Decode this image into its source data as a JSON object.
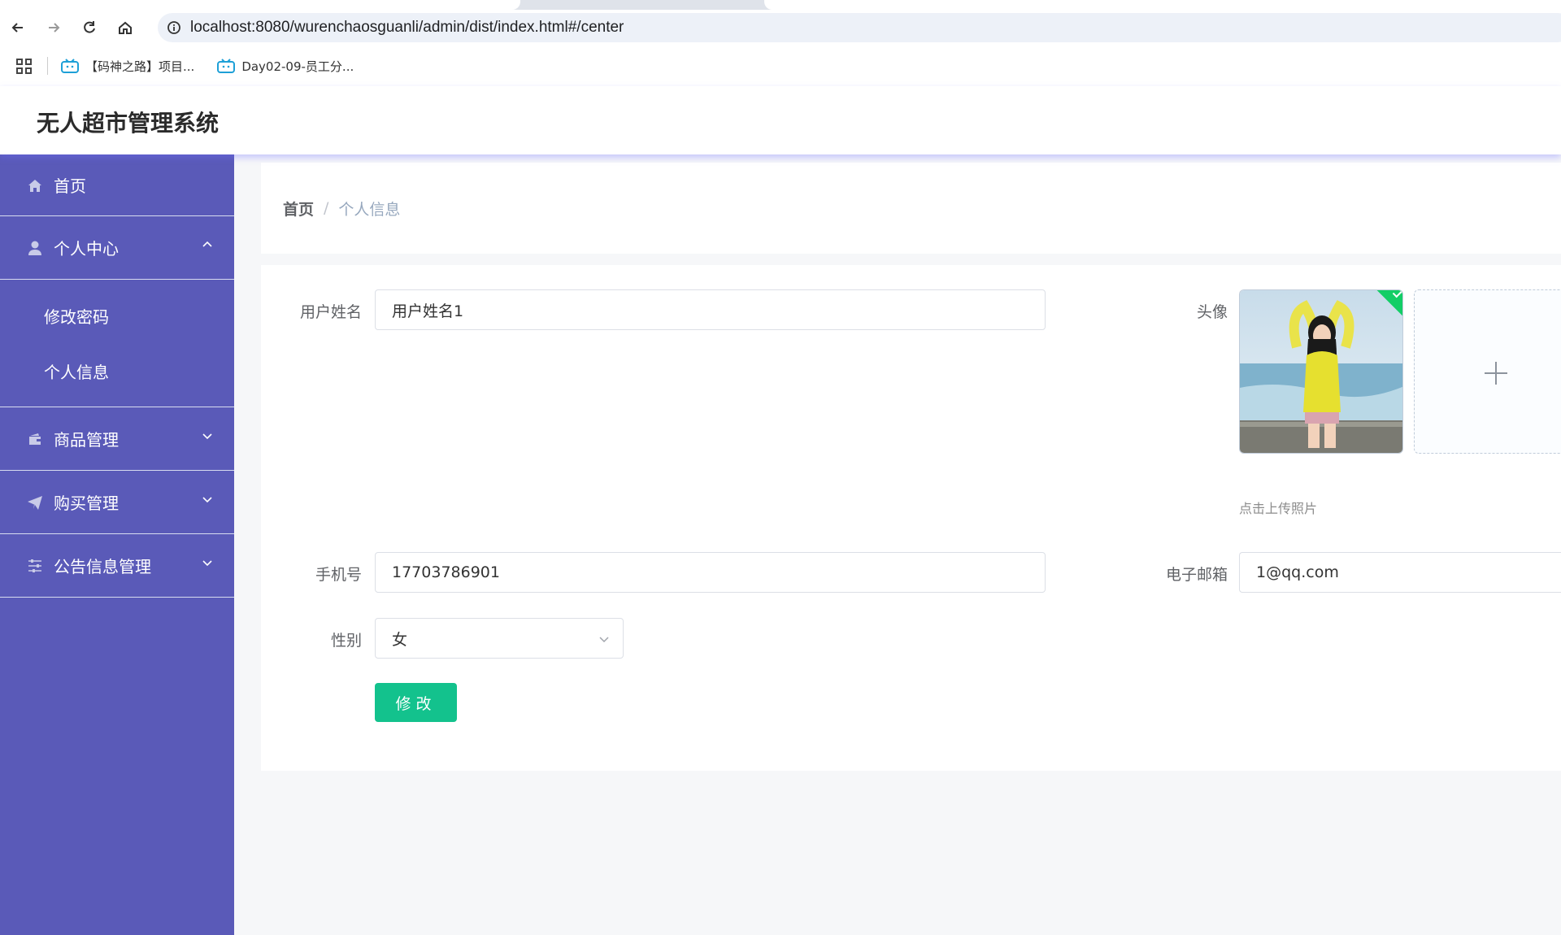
{
  "browser": {
    "url": "localhost:8080/wurenchaosguanli/admin/dist/index.html#/center",
    "icons": [
      "back-icon",
      "forward-icon",
      "reload-icon",
      "home-icon",
      "site-info-icon"
    ],
    "bookmarks": [
      {
        "label": "【码神之路】项目...",
        "icon": "bilibili-tv-icon"
      },
      {
        "label": "Day02-09-员工分...",
        "icon": "bilibili-tv-icon"
      }
    ]
  },
  "app": {
    "title": "无人超市管理系统"
  },
  "sidebar": {
    "items": [
      {
        "label": "首页",
        "icon": "home-icon"
      },
      {
        "label": "个人中心",
        "icon": "user-icon",
        "expanded": true,
        "children": [
          {
            "label": "修改密码"
          },
          {
            "label": "个人信息"
          }
        ]
      },
      {
        "label": "商品管理",
        "icon": "wallet-icon"
      },
      {
        "label": "购买管理",
        "icon": "send-icon"
      },
      {
        "label": "公告信息管理",
        "icon": "sliders-icon"
      }
    ]
  },
  "breadcrumb": {
    "home": "首页",
    "separator": "/",
    "current": "个人信息"
  },
  "form": {
    "username_label": "用户姓名",
    "username_value": "用户姓名1",
    "avatar_label": "头像",
    "upload_hint": "点击上传照片",
    "phone_label": "手机号",
    "phone_value": "17703786901",
    "email_label": "电子邮箱",
    "email_value": "1@qq.com",
    "gender_label": "性别",
    "gender_value": "女",
    "submit_label": "修改"
  },
  "colors": {
    "sidebar_bg": "#5a5ab8",
    "primary_button": "#13c28d",
    "upload_success": "#13ce66"
  }
}
